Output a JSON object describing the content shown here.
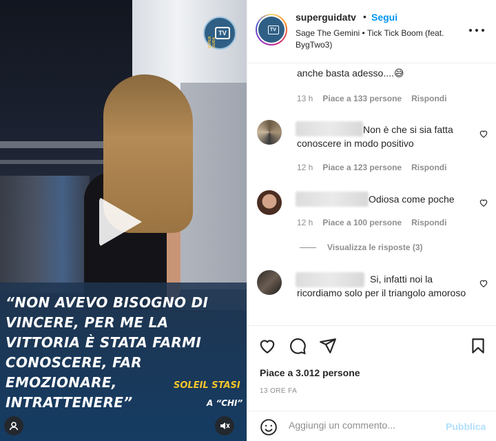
{
  "video": {
    "logo": {
      "vertical_text": "SUPER GUIDA",
      "badge_text": "TV"
    },
    "quote": "“Non avevo bisogno di vincere, per me la vittoria è stata farmi conoscere, far emozionare, intrattenere”",
    "speaker": "Soleil Stasi",
    "source": "a “Chi”",
    "icons": {
      "play": "play-icon",
      "user": "user-tag-icon",
      "mute": "speaker-muted-icon"
    }
  },
  "post": {
    "header": {
      "username": "superguidatv",
      "separator": "•",
      "follow_label": "Segui",
      "audio": "Sage The Gemini • Tick Tick Boom (feat. BygTwo3)",
      "avatar_badge": "TV"
    },
    "comments": [
      {
        "text": "anche basta adesso....😅",
        "time": "13 h",
        "likes": "Piace a 133 persone",
        "reply": "Rispondi"
      },
      {
        "text": "Non è che si sia fatta conoscere in modo positivo",
        "time": "12 h",
        "likes": "Piace a 123 persone",
        "reply": "Rispondi"
      },
      {
        "text": "Odiosa come poche",
        "time": "12 h",
        "likes": "Piace a 100 persone",
        "reply": "Rispondi",
        "view_replies": "Visualizza le risposte (3)"
      },
      {
        "text": "Si, infatti noi la ricordiamo solo per il triangolo amoroso"
      }
    ],
    "actions": {
      "like": "heart-icon",
      "comment": "comment-icon",
      "share": "send-icon",
      "save": "bookmark-icon"
    },
    "likes_total": "Piace a 3.012 persone",
    "posted": "13 ore fa",
    "composer": {
      "placeholder": "Aggiungi un commento...",
      "publish_label": "Pubblica"
    }
  },
  "colors": {
    "accent": "#0095f6",
    "publish_disabled": "#b2dffc",
    "text": "#262626",
    "muted": "#8e8e8e",
    "caption_yellow": "#f5c52a"
  }
}
